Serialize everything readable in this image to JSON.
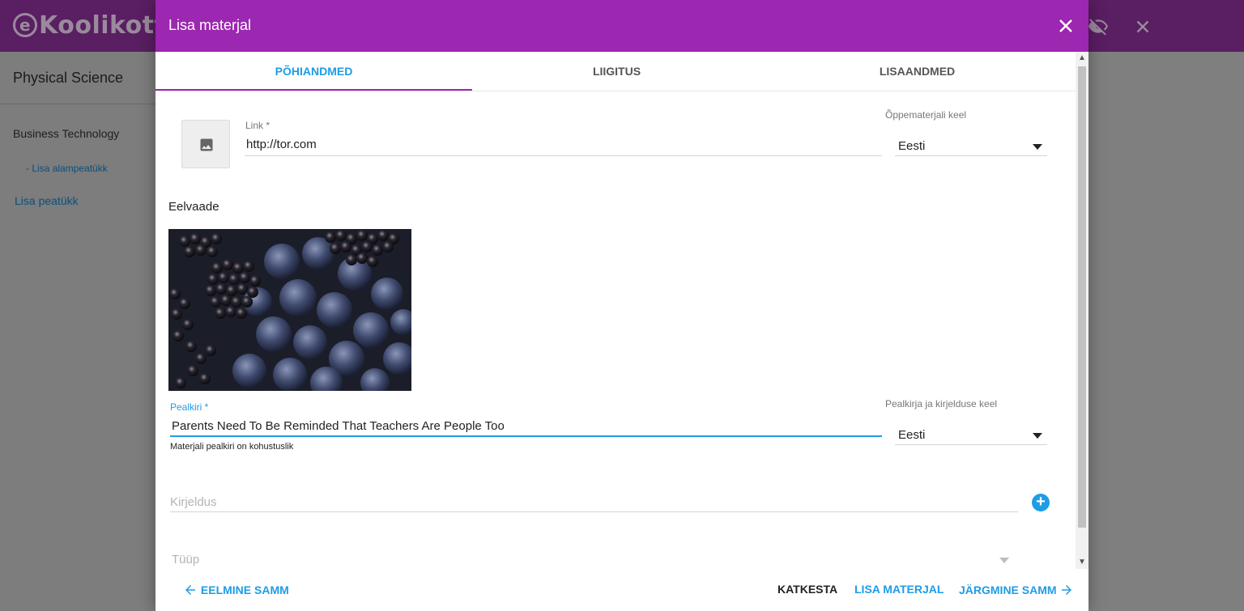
{
  "background": {
    "logo": "Koolikott",
    "course_title": "Physical Science",
    "chapter": "Business Technology",
    "add_subchapter": "- Lisa alampeatükk",
    "add_chapter": "Lisa peatükk"
  },
  "dialog": {
    "title": "Lisa materjal",
    "tabs": [
      {
        "label": "PÕHIANDMED"
      },
      {
        "label": "LIIGITUS"
      },
      {
        "label": "LISAANDMED"
      }
    ],
    "link": {
      "label": "Link *",
      "value": "http://tor.com"
    },
    "material_language": {
      "label": "Õppematerjali keel",
      "value": "Eesti"
    },
    "preview_label": "Eelvaade",
    "title_field": {
      "label": "Pealkiri *",
      "value": "Parents Need To Be Reminded That Teachers Are People Too",
      "hint": "Materjali pealkiri on kohustuslik"
    },
    "title_language": {
      "label": "Pealkirja ja kirjelduse keel",
      "value": "Eesti"
    },
    "description": {
      "placeholder": "Kirjeldus"
    },
    "type": {
      "placeholder": "Tüüp"
    },
    "buttons": {
      "previous": "EELMINE SAMM",
      "cancel": "KATKESTA",
      "add": "LISA MATERJAL",
      "next": "JÄRGMINE SAMM"
    }
  },
  "colors": {
    "header": "#9c27b0",
    "accent": "#1e9ce6",
    "tab_indicator": "#9c27b0"
  }
}
